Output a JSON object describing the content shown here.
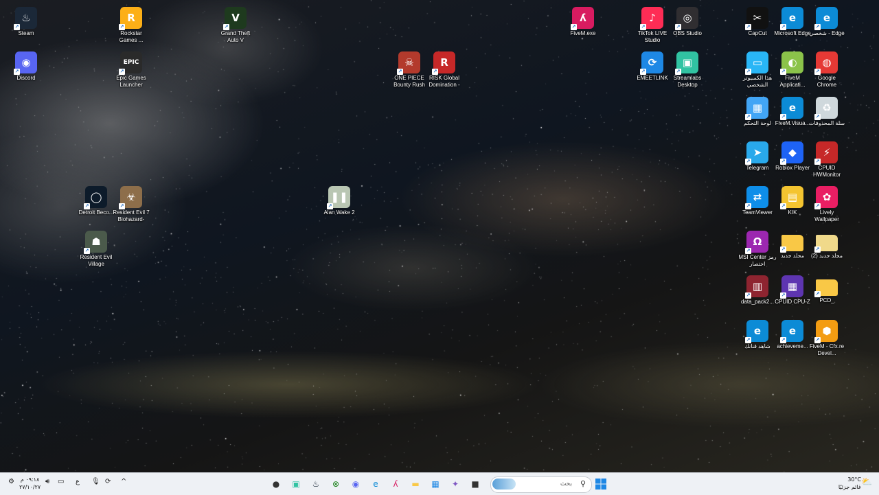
{
  "desktop": {
    "icons": [
      {
        "id": "steam",
        "label": "Steam",
        "glyph": "♨",
        "bg": "#1b2838"
      },
      {
        "id": "discord",
        "label": "Discord",
        "glyph": "◉",
        "bg": "#5865f2"
      },
      {
        "id": "rockstar",
        "label": "Rockstar Games ...",
        "glyph": "R",
        "bg": "#fcaf17"
      },
      {
        "id": "epic",
        "label": "Epic Games Launcher",
        "glyph": "EPIC",
        "bg": "#2a2a2a"
      },
      {
        "id": "gta",
        "label": "Grand Theft Auto V",
        "glyph": "V",
        "bg": "#1e3a1e"
      },
      {
        "id": "onepiece",
        "label": "ONE PIECE Bounty Rush",
        "glyph": "☠",
        "bg": "#b33a2c"
      },
      {
        "id": "risk",
        "label": "RISK Global Domination -",
        "glyph": "R",
        "bg": "#c62828"
      },
      {
        "id": "fivemexe",
        "label": "FiveM.exe",
        "glyph": "ʎ",
        "bg": "#d81b60"
      },
      {
        "id": "tiktok",
        "label": "TikTok LIVE Studio",
        "glyph": "♪",
        "bg": "#fe2c55"
      },
      {
        "id": "obs",
        "label": "OBS Studio",
        "glyph": "◎",
        "bg": "#302e31"
      },
      {
        "id": "emeet",
        "label": "EMEETLINK",
        "glyph": "⟳",
        "bg": "#1e88e5"
      },
      {
        "id": "streamlabs",
        "label": "Streamlabs Desktop",
        "glyph": "▣",
        "bg": "#31c3a2"
      },
      {
        "id": "capcut",
        "label": "CapCut",
        "glyph": "✂",
        "bg": "#111111"
      },
      {
        "id": "edge",
        "label": "Microsoft Edge",
        "glyph": "e",
        "bg": "#0c8bd6"
      },
      {
        "id": "edge-personal",
        "label": "شخصي - Edge",
        "glyph": "e",
        "bg": "#0c8bd6"
      },
      {
        "id": "thispc",
        "label": "هذا الكمبيوتر الشخصي",
        "glyph": "▭",
        "bg": "#29b6f6"
      },
      {
        "id": "fivem-app",
        "label": "FiveM Applicati...",
        "glyph": "◐",
        "bg": "#8bc34a"
      },
      {
        "id": "chrome",
        "label": "Google Chrome",
        "glyph": "◍",
        "bg": "#e53935"
      },
      {
        "id": "controlpanel",
        "label": "لوحة التحكم",
        "glyph": "▦",
        "bg": "#42a5f5"
      },
      {
        "id": "fivem-visual",
        "label": "FiveM.Visua...",
        "glyph": "e",
        "bg": "#0c8bd6"
      },
      {
        "id": "recyclebin",
        "label": "سلة المحذوفات",
        "glyph": "♻",
        "bg": "#cfd8dc"
      },
      {
        "id": "telegram",
        "label": "Telegram",
        "glyph": "➤",
        "bg": "#29a9eb"
      },
      {
        "id": "roblox",
        "label": "Roblox Player",
        "glyph": "◆",
        "bg": "#1e63f5"
      },
      {
        "id": "hwmonitor",
        "label": "CPUID HWMonitor",
        "glyph": "⚡",
        "bg": "#c62828"
      },
      {
        "id": "teamviewer",
        "label": "TeamViewer",
        "glyph": "⇄",
        "bg": "#0e8ee9"
      },
      {
        "id": "kik",
        "label": "KIK",
        "glyph": "▤",
        "bg": "#f4c430"
      },
      {
        "id": "lively",
        "label": "Lively Wallpaper",
        "glyph": "✿",
        "bg": "#e91e63"
      },
      {
        "id": "msi",
        "label": "MSI Center رمز اختصار",
        "glyph": "Ω",
        "bg": "#9c27b0"
      },
      {
        "id": "newfolder",
        "label": "مجلد جديد",
        "glyph": "",
        "bg": "#f9c846"
      },
      {
        "id": "newfolder2",
        "label": "(2) مجلد جديد",
        "glyph": "",
        "bg": "#f0d98a"
      },
      {
        "id": "datapack",
        "label": "data_pack2...",
        "glyph": "▥",
        "bg": "#8e2430"
      },
      {
        "id": "cpuz",
        "label": "CPUID CPU-Z",
        "glyph": "▦",
        "bg": "#5e35b1"
      },
      {
        "id": "pcd",
        "label": "PCD_",
        "glyph": "",
        "bg": "#f9c846"
      },
      {
        "id": "shahid",
        "label": "شاهد قنانك",
        "glyph": "e",
        "bg": "#0c8bd6"
      },
      {
        "id": "achieveme",
        "label": "achieveme...",
        "glyph": "e",
        "bg": "#0c8bd6"
      },
      {
        "id": "fivem-dev",
        "label": "FiveM - Cfx.re Devel...",
        "glyph": "⬢",
        "bg": "#f39c12"
      },
      {
        "id": "detroit",
        "label": "Detroit Beco...",
        "glyph": "◯",
        "bg": "#0d1b2a"
      },
      {
        "id": "re7",
        "label": "Resident Evil 7 Biohazard-",
        "glyph": "☣",
        "bg": "#8d6e4a"
      },
      {
        "id": "re-village",
        "label": "Resident Evil Village",
        "glyph": "☗",
        "bg": "#4b5a4b"
      },
      {
        "id": "alanwake",
        "label": "Alan Wake 2",
        "glyph": "❚❚",
        "bg": "#b9c6b3"
      }
    ]
  },
  "taskbar": {
    "search_placeholder": "بحث",
    "clock": {
      "time": "٠٩:١٨ م",
      "date": "٢٧/١٠/٢٧"
    },
    "weather": {
      "temp": "30°C",
      "desc": "غائم جزئيًا"
    },
    "tray": {
      "lang": "ع",
      "chevron": "^"
    },
    "pinned": [
      {
        "id": "gta",
        "glyph": "●",
        "color": "#333"
      },
      {
        "id": "streamlabs",
        "glyph": "▣",
        "color": "#31c3a2"
      },
      {
        "id": "steam",
        "glyph": "♨",
        "color": "#1b2838"
      },
      {
        "id": "xbox",
        "glyph": "⊗",
        "color": "#107c10"
      },
      {
        "id": "discord",
        "glyph": "◉",
        "color": "#5865f2"
      },
      {
        "id": "edge",
        "glyph": "e",
        "color": "#0c8bd6"
      },
      {
        "id": "fivem",
        "glyph": "ʎ",
        "color": "#d81b60"
      },
      {
        "id": "explorer",
        "glyph": "▬",
        "color": "#f9c846"
      },
      {
        "id": "store",
        "glyph": "▦",
        "color": "#1e88e5"
      },
      {
        "id": "copilot",
        "glyph": "✦",
        "color": "#7e57c2"
      },
      {
        "id": "app",
        "glyph": "■",
        "color": "#333"
      }
    ]
  }
}
